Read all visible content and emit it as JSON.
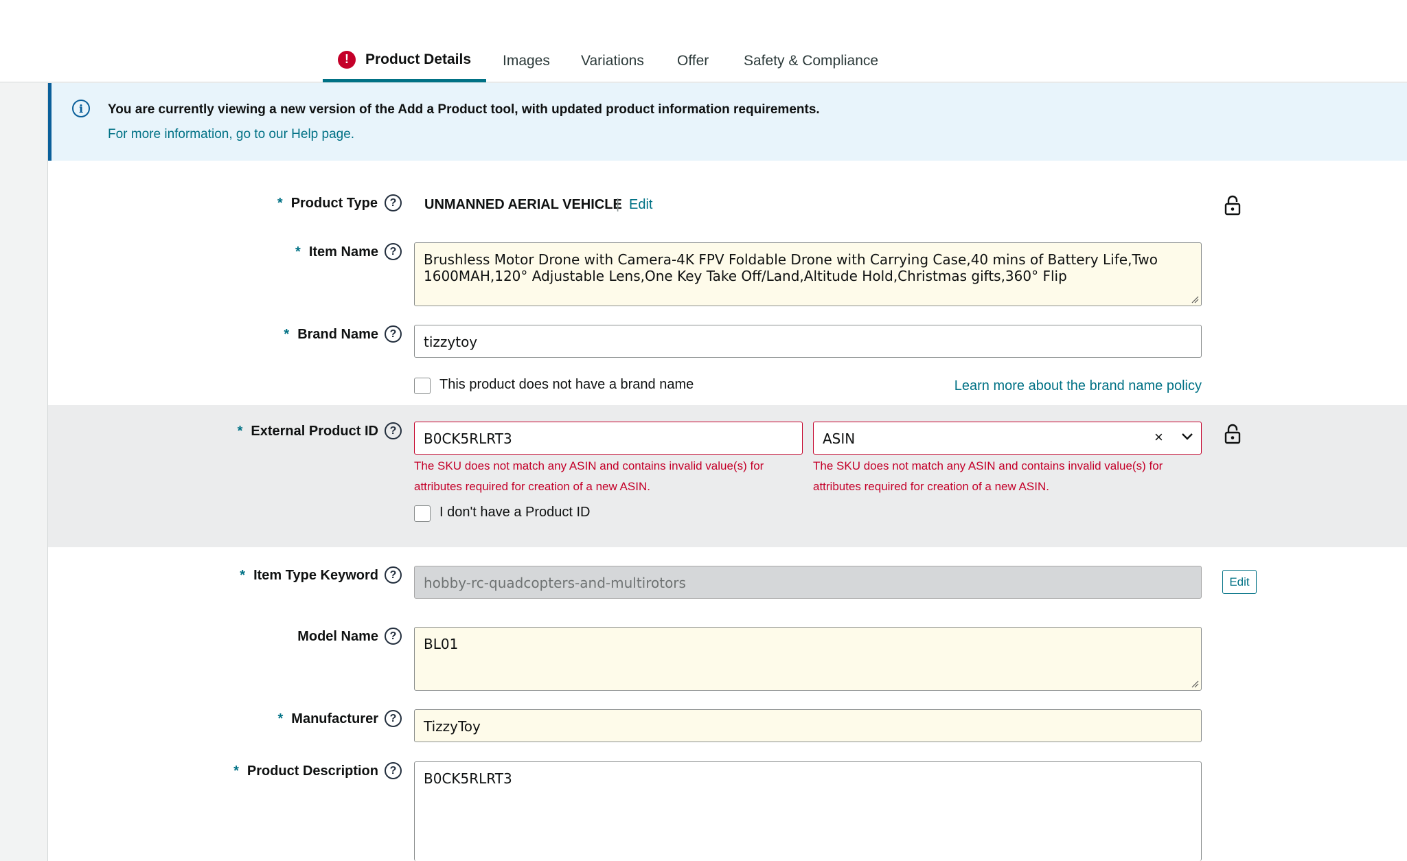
{
  "tabs": [
    {
      "label": "Product Details",
      "active": true,
      "alert": true
    },
    {
      "label": "Images"
    },
    {
      "label": "Variations"
    },
    {
      "label": "Offer"
    },
    {
      "label": "Safety & Compliance"
    }
  ],
  "banner": {
    "title": "You are currently viewing a new version of the Add a Product tool, with updated product information requirements.",
    "link": "For more information, go to our Help page."
  },
  "form": {
    "product_type": {
      "label": "Product Type",
      "value": "UNMANNED AERIAL VEHICLE",
      "sep": "|",
      "edit": "Edit"
    },
    "item_name": {
      "label": "Item Name",
      "value": "Brushless Motor Drone with Camera-4K FPV Foldable Drone with Carrying Case,40 mins of Battery Life,Two 1600MAH,120° Adjustable Lens,One Key Take Off/Land,Altitude Hold,Christmas gifts,360° Flip"
    },
    "brand_name": {
      "label": "Brand Name",
      "value": "tizzytoy",
      "no_brand_label": "This product does not have a brand name",
      "policy_link": "Learn more about the brand name policy"
    },
    "external_id": {
      "label": "External Product ID",
      "value": "B0CK5RLRT3",
      "type_value": "ASIN",
      "error": "The SKU does not match any ASIN and contains invalid value(s) for attributes required for creation of a new ASIN.",
      "type_error": "The SKU does not match any ASIN and contains invalid value(s) for attributes required for creation of a new ASIN.",
      "no_id_label": "I don't have a Product ID"
    },
    "item_type_keyword": {
      "label": "Item Type Keyword",
      "value": "hobby-rc-quadcopters-and-multirotors",
      "edit": "Edit"
    },
    "model_name": {
      "label": "Model Name",
      "value": "BL01"
    },
    "manufacturer": {
      "label": "Manufacturer",
      "value": "TizzyToy"
    },
    "product_description": {
      "label": "Product Description",
      "value": "B0CK5RLRT3"
    }
  },
  "icons": {
    "help": "?",
    "info": "i",
    "alert": "!",
    "clear": "×"
  },
  "colors": {
    "accent": "#007185",
    "error": "#c40029",
    "banner_bg": "#e8f4fb",
    "field_highlight": "#fefbea"
  }
}
